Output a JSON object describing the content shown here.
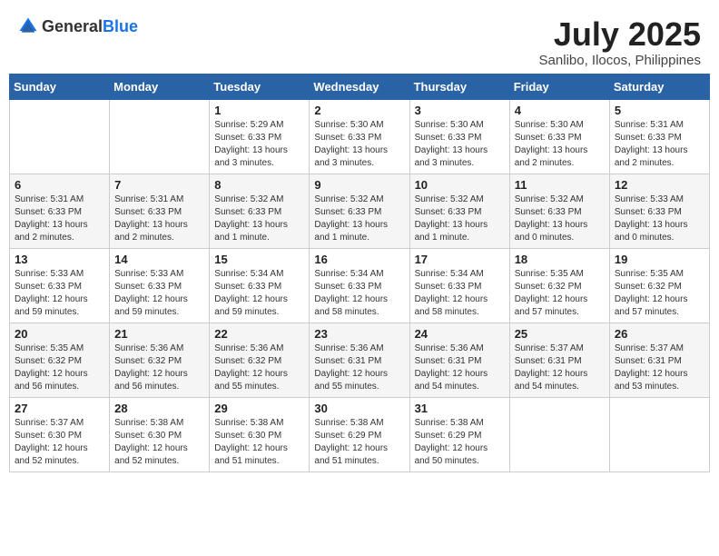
{
  "header": {
    "logo_general": "General",
    "logo_blue": "Blue",
    "month_title": "July 2025",
    "subtitle": "Sanlibo, Ilocos, Philippines"
  },
  "days_of_week": [
    "Sunday",
    "Monday",
    "Tuesday",
    "Wednesday",
    "Thursday",
    "Friday",
    "Saturday"
  ],
  "weeks": [
    [
      {
        "day": "",
        "detail": ""
      },
      {
        "day": "",
        "detail": ""
      },
      {
        "day": "1",
        "detail": "Sunrise: 5:29 AM\nSunset: 6:33 PM\nDaylight: 13 hours and 3 minutes."
      },
      {
        "day": "2",
        "detail": "Sunrise: 5:30 AM\nSunset: 6:33 PM\nDaylight: 13 hours and 3 minutes."
      },
      {
        "day": "3",
        "detail": "Sunrise: 5:30 AM\nSunset: 6:33 PM\nDaylight: 13 hours and 3 minutes."
      },
      {
        "day": "4",
        "detail": "Sunrise: 5:30 AM\nSunset: 6:33 PM\nDaylight: 13 hours and 2 minutes."
      },
      {
        "day": "5",
        "detail": "Sunrise: 5:31 AM\nSunset: 6:33 PM\nDaylight: 13 hours and 2 minutes."
      }
    ],
    [
      {
        "day": "6",
        "detail": "Sunrise: 5:31 AM\nSunset: 6:33 PM\nDaylight: 13 hours and 2 minutes."
      },
      {
        "day": "7",
        "detail": "Sunrise: 5:31 AM\nSunset: 6:33 PM\nDaylight: 13 hours and 2 minutes."
      },
      {
        "day": "8",
        "detail": "Sunrise: 5:32 AM\nSunset: 6:33 PM\nDaylight: 13 hours and 1 minute."
      },
      {
        "day": "9",
        "detail": "Sunrise: 5:32 AM\nSunset: 6:33 PM\nDaylight: 13 hours and 1 minute."
      },
      {
        "day": "10",
        "detail": "Sunrise: 5:32 AM\nSunset: 6:33 PM\nDaylight: 13 hours and 1 minute."
      },
      {
        "day": "11",
        "detail": "Sunrise: 5:32 AM\nSunset: 6:33 PM\nDaylight: 13 hours and 0 minutes."
      },
      {
        "day": "12",
        "detail": "Sunrise: 5:33 AM\nSunset: 6:33 PM\nDaylight: 13 hours and 0 minutes."
      }
    ],
    [
      {
        "day": "13",
        "detail": "Sunrise: 5:33 AM\nSunset: 6:33 PM\nDaylight: 12 hours and 59 minutes."
      },
      {
        "day": "14",
        "detail": "Sunrise: 5:33 AM\nSunset: 6:33 PM\nDaylight: 12 hours and 59 minutes."
      },
      {
        "day": "15",
        "detail": "Sunrise: 5:34 AM\nSunset: 6:33 PM\nDaylight: 12 hours and 59 minutes."
      },
      {
        "day": "16",
        "detail": "Sunrise: 5:34 AM\nSunset: 6:33 PM\nDaylight: 12 hours and 58 minutes."
      },
      {
        "day": "17",
        "detail": "Sunrise: 5:34 AM\nSunset: 6:33 PM\nDaylight: 12 hours and 58 minutes."
      },
      {
        "day": "18",
        "detail": "Sunrise: 5:35 AM\nSunset: 6:32 PM\nDaylight: 12 hours and 57 minutes."
      },
      {
        "day": "19",
        "detail": "Sunrise: 5:35 AM\nSunset: 6:32 PM\nDaylight: 12 hours and 57 minutes."
      }
    ],
    [
      {
        "day": "20",
        "detail": "Sunrise: 5:35 AM\nSunset: 6:32 PM\nDaylight: 12 hours and 56 minutes."
      },
      {
        "day": "21",
        "detail": "Sunrise: 5:36 AM\nSunset: 6:32 PM\nDaylight: 12 hours and 56 minutes."
      },
      {
        "day": "22",
        "detail": "Sunrise: 5:36 AM\nSunset: 6:32 PM\nDaylight: 12 hours and 55 minutes."
      },
      {
        "day": "23",
        "detail": "Sunrise: 5:36 AM\nSunset: 6:31 PM\nDaylight: 12 hours and 55 minutes."
      },
      {
        "day": "24",
        "detail": "Sunrise: 5:36 AM\nSunset: 6:31 PM\nDaylight: 12 hours and 54 minutes."
      },
      {
        "day": "25",
        "detail": "Sunrise: 5:37 AM\nSunset: 6:31 PM\nDaylight: 12 hours and 54 minutes."
      },
      {
        "day": "26",
        "detail": "Sunrise: 5:37 AM\nSunset: 6:31 PM\nDaylight: 12 hours and 53 minutes."
      }
    ],
    [
      {
        "day": "27",
        "detail": "Sunrise: 5:37 AM\nSunset: 6:30 PM\nDaylight: 12 hours and 52 minutes."
      },
      {
        "day": "28",
        "detail": "Sunrise: 5:38 AM\nSunset: 6:30 PM\nDaylight: 12 hours and 52 minutes."
      },
      {
        "day": "29",
        "detail": "Sunrise: 5:38 AM\nSunset: 6:30 PM\nDaylight: 12 hours and 51 minutes."
      },
      {
        "day": "30",
        "detail": "Sunrise: 5:38 AM\nSunset: 6:29 PM\nDaylight: 12 hours and 51 minutes."
      },
      {
        "day": "31",
        "detail": "Sunrise: 5:38 AM\nSunset: 6:29 PM\nDaylight: 12 hours and 50 minutes."
      },
      {
        "day": "",
        "detail": ""
      },
      {
        "day": "",
        "detail": ""
      }
    ]
  ]
}
